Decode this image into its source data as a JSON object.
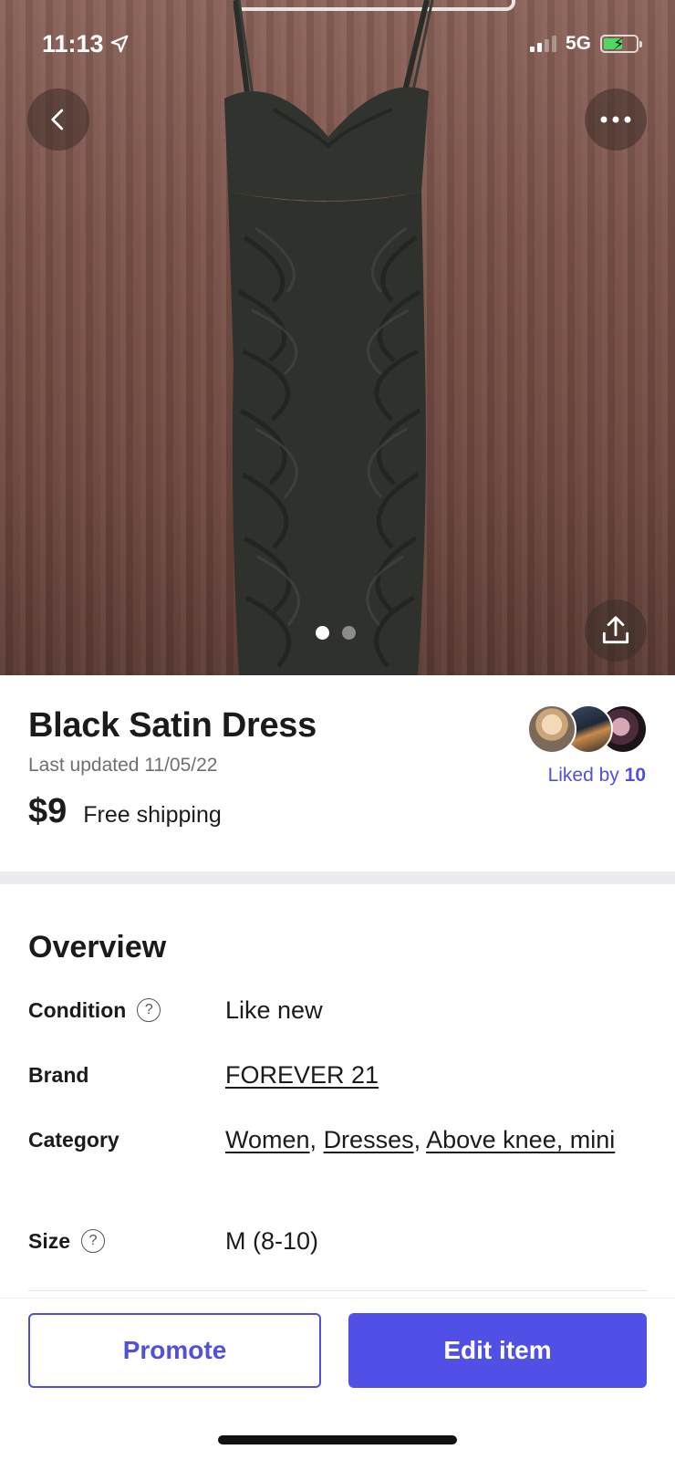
{
  "status_bar": {
    "time": "11:13",
    "network": "5G"
  },
  "hero": {
    "image_description": "Black satin ruched dress on hanger against brown curtain",
    "page_count": 2,
    "active_page": 1
  },
  "listing": {
    "title": "Black Satin Dress",
    "last_updated": "Last updated 11/05/22",
    "price": "$9",
    "shipping": "Free shipping",
    "liked_prefix": "Liked by",
    "liked_count": "10"
  },
  "overview": {
    "heading": "Overview",
    "condition_label": "Condition",
    "condition_value": "Like new",
    "brand_label": "Brand",
    "brand_value": "FOREVER 21",
    "category_label": "Category",
    "category_values": [
      "Women",
      "Dresses",
      "Above knee, mini"
    ],
    "size_label": "Size",
    "size_value": "M (8-10)"
  },
  "actions": {
    "promote_label": "Promote",
    "edit_label": "Edit item"
  },
  "colors": {
    "accent": "#5150e6",
    "accent_text": "#5150d6",
    "battery_green": "#4cd964"
  },
  "icons": {
    "back": "chevron-left-icon",
    "more": "more-horizontal-icon",
    "share": "share-icon",
    "help": "question-circle-icon",
    "location": "location-arrow-icon"
  }
}
